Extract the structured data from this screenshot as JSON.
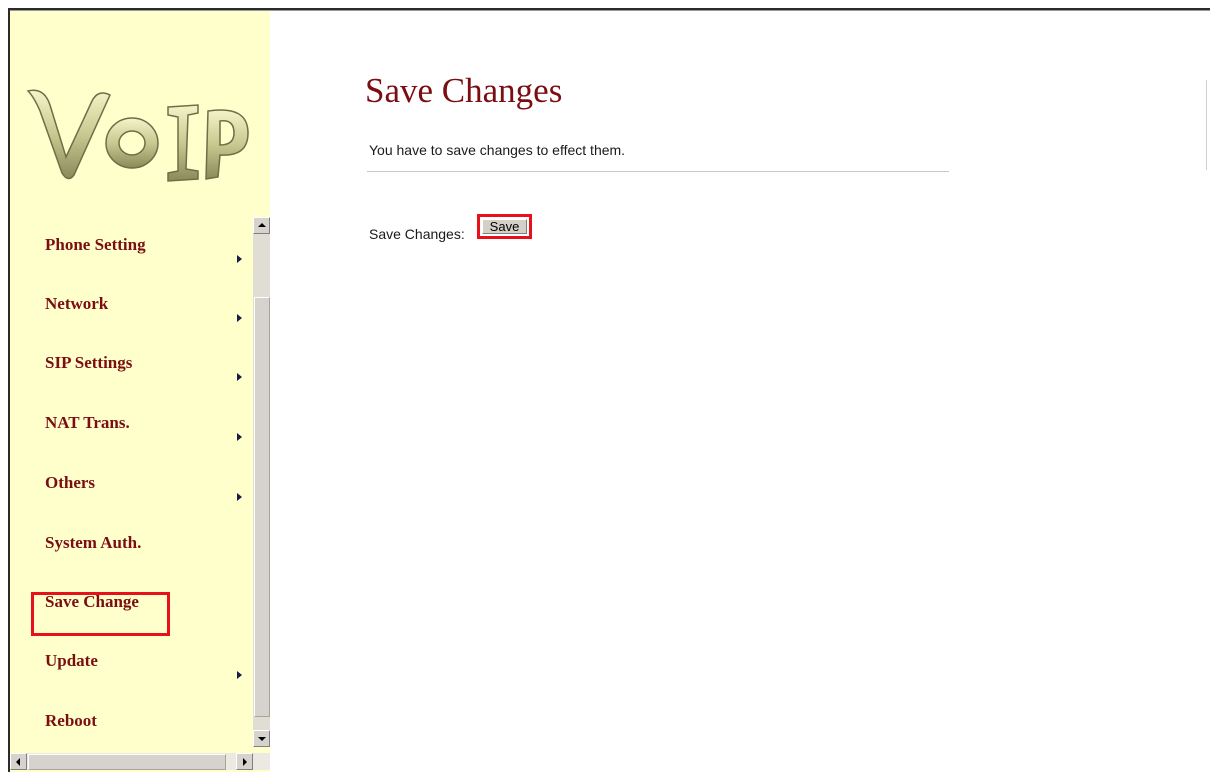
{
  "sidebar": {
    "logo_text": "VoIP",
    "items": [
      {
        "label": "Phone Setting",
        "has_submenu": true
      },
      {
        "label": "Network",
        "has_submenu": true
      },
      {
        "label": "SIP Settings",
        "has_submenu": true
      },
      {
        "label": "NAT Trans.",
        "has_submenu": true
      },
      {
        "label": "Others",
        "has_submenu": true
      },
      {
        "label": "System Auth.",
        "has_submenu": false
      },
      {
        "label": "Save Change",
        "has_submenu": false,
        "highlighted": true
      },
      {
        "label": "Update",
        "has_submenu": true
      },
      {
        "label": "Reboot",
        "has_submenu": false
      }
    ]
  },
  "main": {
    "title": "Save Changes",
    "description": "You have to save changes to effect them.",
    "save_row_label": "Save Changes:",
    "save_button_label": "Save"
  },
  "colors": {
    "sidebar_bg": "#ffffcc",
    "menu_text": "#7a0e12",
    "title_text": "#7a0e12",
    "highlight": "#e8101a"
  }
}
